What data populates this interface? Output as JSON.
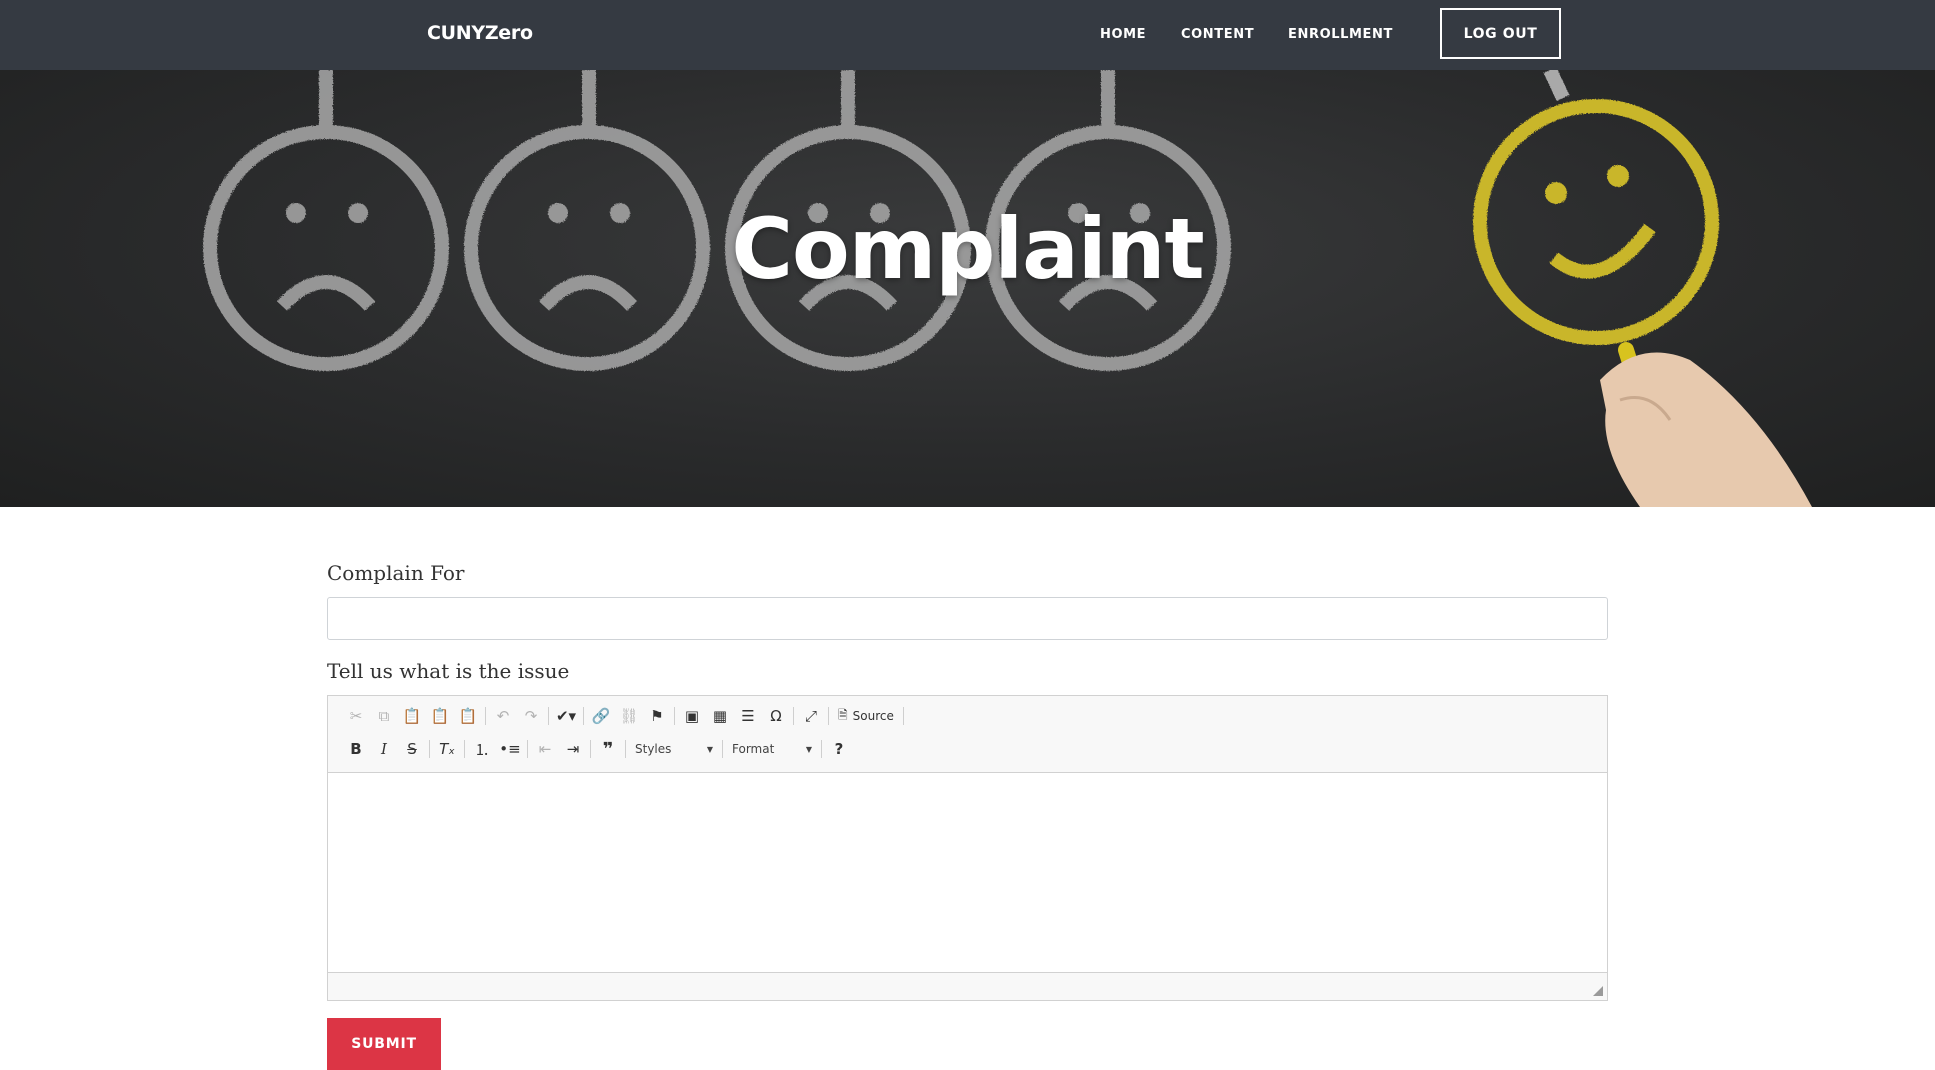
{
  "navbar": {
    "brand": "CUNYZero",
    "links": [
      "HOME",
      "CONTENT",
      "ENROLLMENT"
    ],
    "logout_label": "LOG OUT"
  },
  "hero": {
    "title": "Complaint",
    "background_color": "#2b2c2d",
    "face_color": "#a9a9a9",
    "happy_face_color": "#c9b62a"
  },
  "form": {
    "complain_for_label": "Complain For",
    "complain_for_value": "",
    "issue_label": "Tell us what is the issue",
    "issue_value": "",
    "submit_label": "SUBMIT",
    "submit_color": "#dc3545"
  },
  "editor": {
    "toolbar_row1_icons": [
      "cut-icon",
      "copy-icon",
      "paste-icon",
      "paste-text-icon",
      "paste-word-icon",
      "undo-icon",
      "redo-icon",
      "spellcheck-icon",
      "link-icon",
      "unlink-icon",
      "anchor-icon",
      "image-icon",
      "table-icon",
      "horizontal-line-icon",
      "special-char-icon",
      "maximize-icon"
    ],
    "source_label": "Source",
    "toolbar_row2_icons": [
      "bold-icon",
      "italic-icon",
      "strikethrough-icon",
      "remove-format-icon",
      "numbered-list-icon",
      "bulleted-list-icon",
      "outdent-icon",
      "indent-icon",
      "blockquote-icon",
      "help-icon"
    ],
    "styles_label": "Styles",
    "format_label": "Format"
  }
}
